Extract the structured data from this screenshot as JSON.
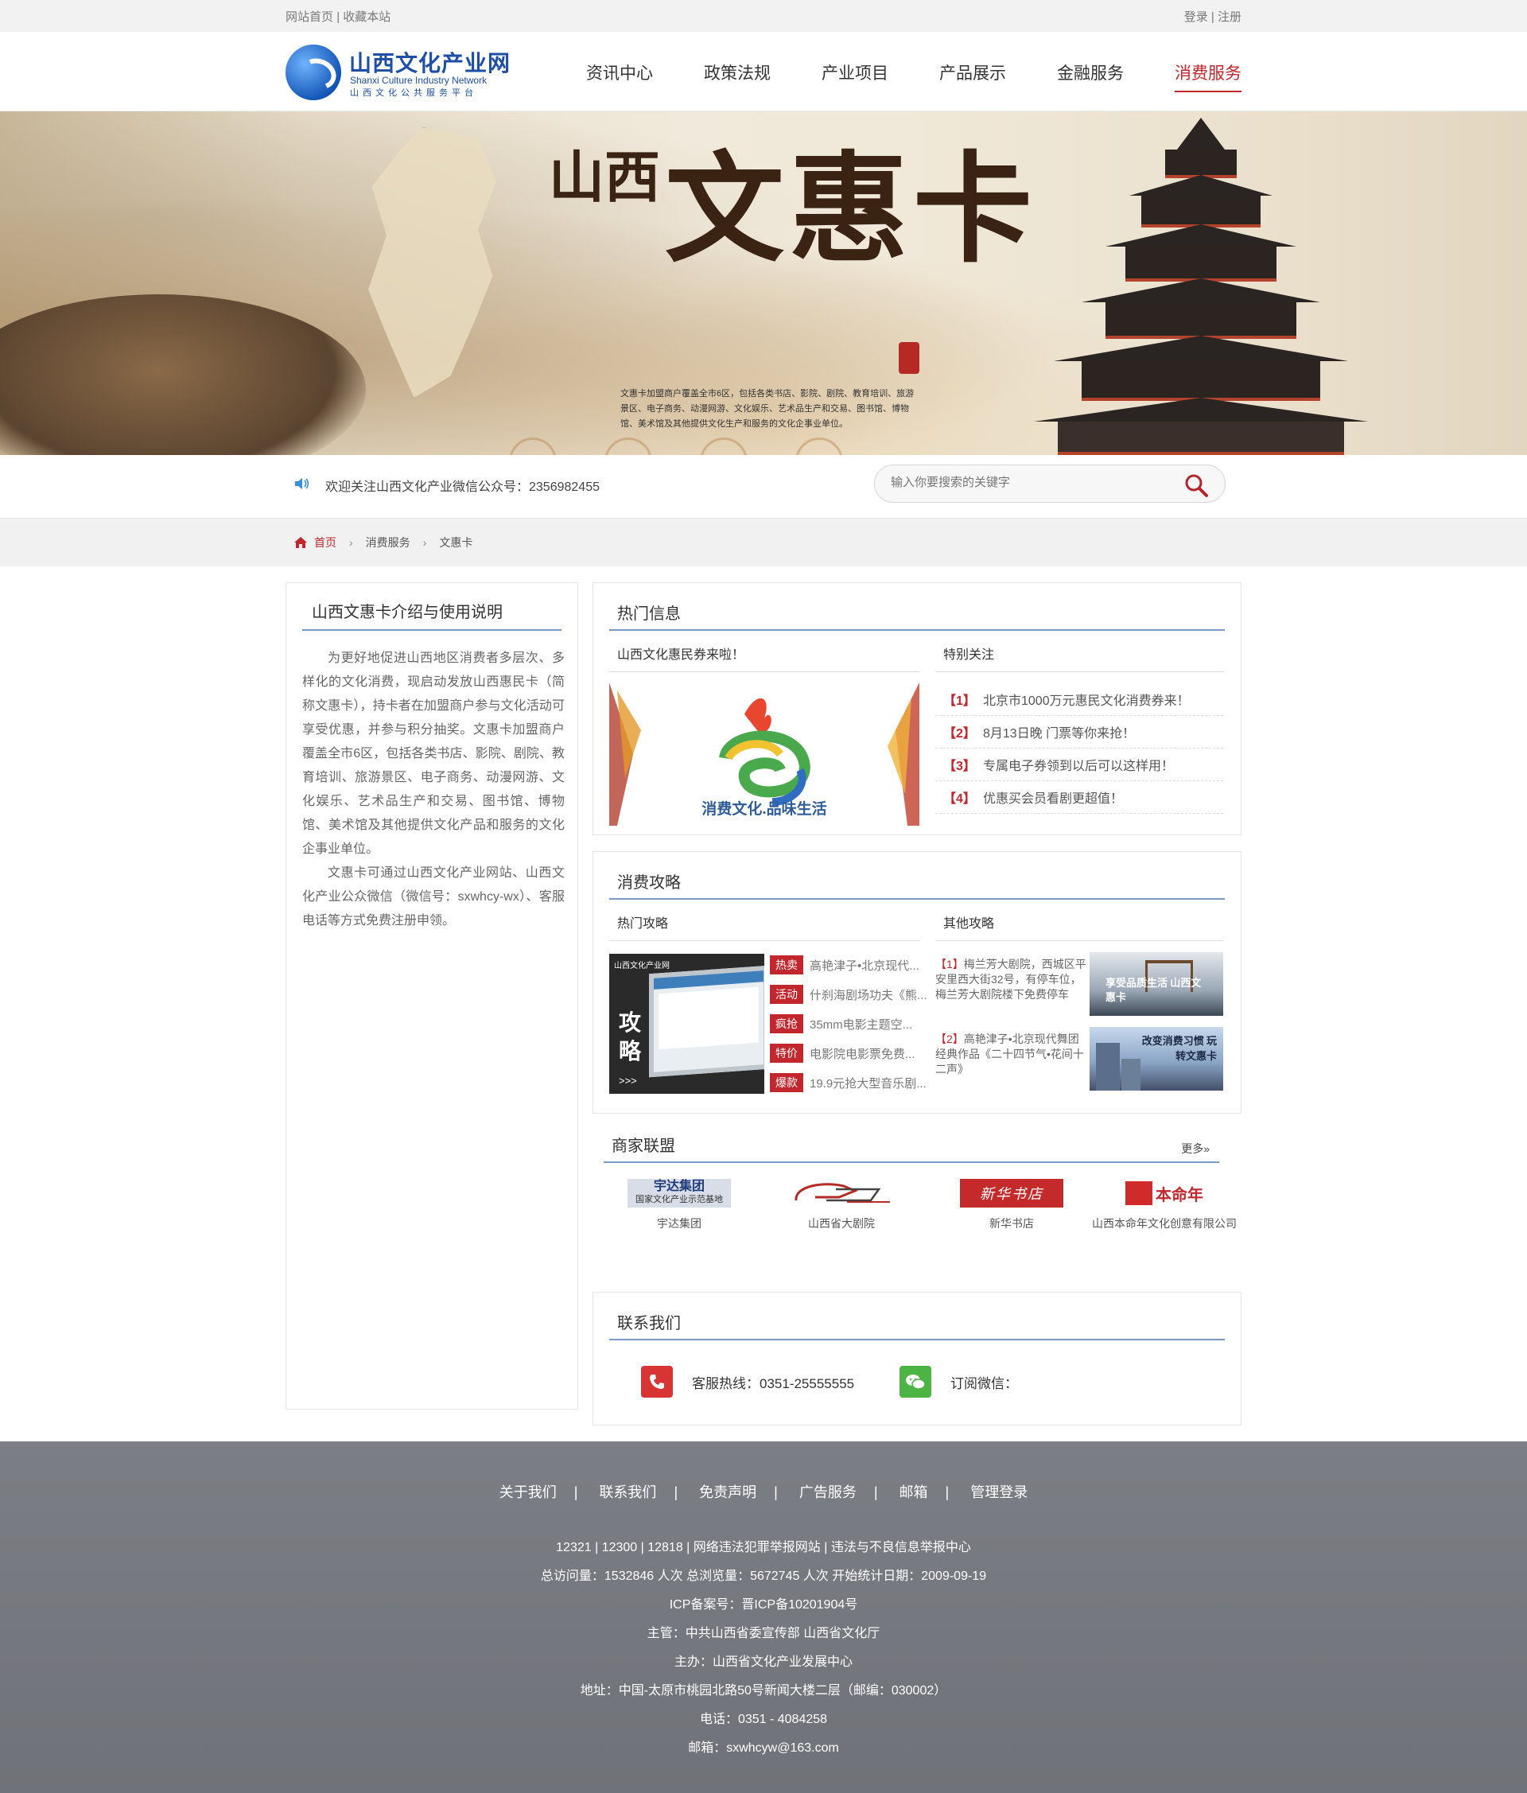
{
  "topbar": {
    "home": "网站首页",
    "sep": "|",
    "favorite": "收藏本站",
    "login": "登录",
    "register": "注册"
  },
  "logo": {
    "title": "山西文化产业网",
    "en": "Shanxi Culture Industry Network",
    "sub": "山西文化公共服务平台"
  },
  "nav": [
    "资讯中心",
    "政策法规",
    "产业项目",
    "产品展示",
    "金融服务",
    "消费服务"
  ],
  "banner": {
    "title_small": "山西",
    "title": "文惠卡",
    "desc": "文惠卡加盟商户覆盖全市6区，包括各类书店、影院、剧院、教育培训、旅游景区、电子商务、动漫网游、文化娱乐、艺术品生产和交易、图书馆、博物馆、美术馆及其他提供文化生产和服务的文化企事业单位。"
  },
  "infobar": {
    "notice": "欢迎关注山西文化产业微信公众号：2356982455",
    "search_placeholder": "输入你要搜索的关键字"
  },
  "breadcrumb": {
    "home": "首页",
    "level1": "消费服务",
    "level2": "文惠卡",
    "sep": "›"
  },
  "left": {
    "title": "山西文惠卡介绍与使用说明",
    "p1": "为更好地促进山西地区消费者多层次、多样化的文化消费，现启动发放山西惠民卡（简称文惠卡），持卡者在加盟商户参与文化活动可享受优惠，并参与积分抽奖。文惠卡加盟商户覆盖全市6区，包括各类书店、影院、剧院、教育培训、旅游景区、电子商务、动漫网游、文化娱乐、艺术品生产和交易、图书馆、博物馆、美术馆及其他提供文化产品和服务的文化企事业单位。",
    "p2": "文惠卡可通过山西文化产业网站、山西文化产业公众微信（微信号：sxwhcy-wx）、客服电话等方式免费注册申领。"
  },
  "hot": {
    "title": "热门信息",
    "left_title": "山西文化惠民券来啦！",
    "img_caption": "消费文化.品味生活",
    "right_title": "特别关注",
    "items": [
      {
        "num": "【1】",
        "text": "北京市1000万元惠民文化消费券来！"
      },
      {
        "num": "【2】",
        "text": "8月13日晚 门票等你来抢！"
      },
      {
        "num": "【3】",
        "text": "专属电子券领到以后可以这样用！"
      },
      {
        "num": "【4】",
        "text": "优惠买会员看剧更超值！"
      }
    ]
  },
  "guide": {
    "title": "消费攻略",
    "left_title": "热门攻略",
    "img_text1": "攻",
    "img_text2": "略",
    "img_arrow": ">>>",
    "img_brand": "山西文化产业网",
    "right_title": "其他攻略",
    "tags": [
      {
        "tag": "热卖",
        "text": "高艳津子•北京现代..."
      },
      {
        "tag": "活动",
        "text": "什刹海剧场功夫《熊..."
      },
      {
        "tag": "疯抢",
        "text": "35mm电影主题空..."
      },
      {
        "tag": "特价",
        "text": "电影院电影票免费..."
      },
      {
        "tag": "爆款",
        "text": "19.9元抢大型音乐剧..."
      }
    ],
    "others": [
      {
        "num": "【1】",
        "text": "梅兰芳大剧院，西城区平安里西大街32号，有停车位，梅兰芳大剧院楼下免费停车",
        "img_text": "享受品质生活 山西文惠卡"
      },
      {
        "num": "【2】",
        "text": "高艳津子•北京现代舞团经典作品《二十四节气•花间十二声》",
        "img_text": "改变消费习惯 玩转文惠卡"
      }
    ]
  },
  "merchant": {
    "title": "商家联盟",
    "more": "更多»",
    "items": [
      {
        "name": "宇达集团",
        "logo_text": "宇达集团",
        "logo_sub": "国家文化产业示范基地"
      },
      {
        "name": "山西省大剧院",
        "logo_text": ""
      },
      {
        "name": "新华书店",
        "logo_text": "新华书店"
      },
      {
        "name": "山西本命年文化创意有限公司",
        "logo_text": "本命年"
      }
    ]
  },
  "contact": {
    "title": "联系我们",
    "phone_label": "客服热线：0351-25555555",
    "wechat_label": "订阅微信："
  },
  "footer": {
    "links": [
      "关于我们",
      "联系我们",
      "免责声明",
      "广告服务",
      "邮箱",
      "管理登录"
    ],
    "sep": "|",
    "lines": [
      "12321 | 12300 | 12818 | 网络违法犯罪举报网站 | 违法与不良信息举报中心",
      "总访问量：1532846 人次  总浏览量：5672745 人次  开始统计日期：2009-09-19",
      "ICP备案号：晋ICP备10201904号",
      "主管：中共山西省委宣传部 山西省文化厅",
      "主办：山西省文化产业发展中心",
      "地址：中国-太原市桃园北路50号新闻大楼二层（邮编：030002）",
      "电话：0351 - 4084258",
      "邮箱：sxwhcyw@163.com"
    ]
  },
  "colors": {
    "accent": "#c1272d",
    "brand_blue": "#1d4fa6",
    "rule": "#7b99c9",
    "footer_bg": "#777a80"
  }
}
